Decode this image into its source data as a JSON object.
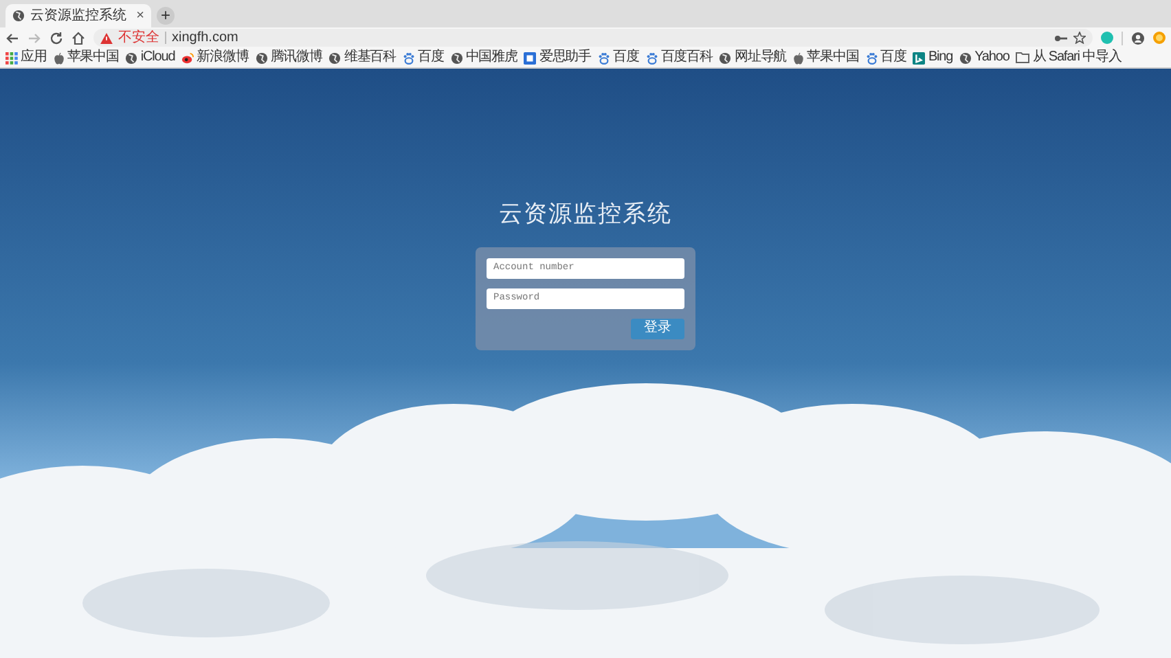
{
  "tab": {
    "title": "云资源监控系统",
    "close": "×",
    "selected": true
  },
  "new_tab": "+",
  "address_bar": {
    "warning": "不安全",
    "url": "xingfh.com"
  },
  "bookmarks": [
    {
      "kind": "apps",
      "label": "应用"
    },
    {
      "kind": "apple",
      "label": "苹果中国"
    },
    {
      "kind": "globe",
      "label": "iCloud"
    },
    {
      "kind": "weibo",
      "label": "新浪微博"
    },
    {
      "kind": "globe",
      "label": "腾讯微博"
    },
    {
      "kind": "globe",
      "label": "维基百科"
    },
    {
      "kind": "paw",
      "label": "百度"
    },
    {
      "kind": "globe",
      "label": "中国雅虎"
    },
    {
      "kind": "square",
      "label": "爱思助手"
    },
    {
      "kind": "paw",
      "label": "百度"
    },
    {
      "kind": "paw",
      "label": "百度百科"
    },
    {
      "kind": "globe",
      "label": "网址导航"
    },
    {
      "kind": "apple",
      "label": "苹果中国"
    },
    {
      "kind": "paw",
      "label": "百度"
    },
    {
      "kind": "bing",
      "label": "Bing"
    },
    {
      "kind": "globe",
      "label": "Yahoo"
    },
    {
      "kind": "folder",
      "label": "从 Safari 中导入"
    }
  ],
  "login": {
    "title": "云资源监控系统",
    "account_placeholder": "Account number",
    "password_placeholder": "Password",
    "submit": "登录"
  }
}
